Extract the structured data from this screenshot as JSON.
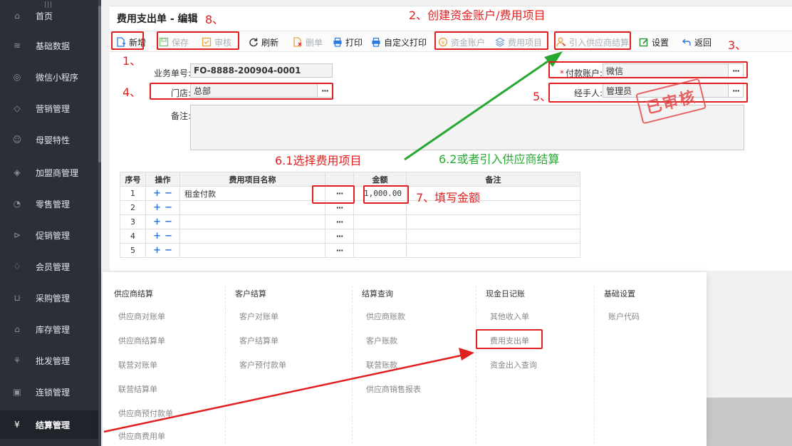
{
  "sidebar": {
    "items": [
      {
        "label": "首页",
        "icon": "home-icon"
      },
      {
        "label": "基础数据",
        "icon": "layers-icon"
      },
      {
        "label": "微信小程序",
        "icon": "mini-program-icon"
      },
      {
        "label": "营销管理",
        "icon": "diamond-icon"
      },
      {
        "label": "母婴特性",
        "icon": "smile-icon"
      },
      {
        "label": "加盟商管理",
        "icon": "franchise-icon"
      },
      {
        "label": "零售管理",
        "icon": "tag-icon"
      },
      {
        "label": "促销管理",
        "icon": "promo-icon"
      },
      {
        "label": "会员管理",
        "icon": "member-icon"
      },
      {
        "label": "采购管理",
        "icon": "cart-icon"
      },
      {
        "label": "库存管理",
        "icon": "warehouse-icon"
      },
      {
        "label": "批发管理",
        "icon": "wholesale-icon"
      },
      {
        "label": "连锁管理",
        "icon": "chain-icon"
      },
      {
        "label": "结算管理",
        "icon": "settlement-icon",
        "active": true
      }
    ]
  },
  "page": {
    "title": "费用支出单 - 编辑"
  },
  "toolbar": {
    "new": "新增",
    "save": "保存",
    "audit": "审核",
    "refresh": "刷新",
    "delete": "删单",
    "print": "打印",
    "custom_print": "自定义打印",
    "fund_account": "资金账户",
    "expense_item": "费用项目",
    "import_supplier": "引入供应商结算",
    "settings": "设置",
    "back": "返回"
  },
  "form": {
    "doc_no_label": "业务单号:",
    "doc_no": "FO-8888-200904-0001",
    "store_label": "门店:",
    "store": "总部",
    "pay_account_label": "付款账户:",
    "pay_account": "微信",
    "handler_label": "经手人:",
    "handler": "管理员",
    "remark_label": "备注:",
    "ellipsis": "···"
  },
  "stamp": {
    "text": "已审核"
  },
  "grid": {
    "headers": [
      "序号",
      "操作",
      "费用项目名称",
      "",
      "金额",
      "备注"
    ],
    "rows": [
      {
        "no": "1",
        "name": "租金付款",
        "amount": "1,000.00",
        "remark": ""
      },
      {
        "no": "2",
        "name": "",
        "amount": "",
        "remark": ""
      },
      {
        "no": "3",
        "name": "",
        "amount": "",
        "remark": ""
      },
      {
        "no": "4",
        "name": "",
        "amount": "",
        "remark": ""
      },
      {
        "no": "5",
        "name": "",
        "amount": "",
        "remark": ""
      }
    ],
    "plus": "+",
    "minus": "−",
    "dots": "···"
  },
  "menu": {
    "columns": [
      {
        "header": "供应商结算",
        "items": [
          "供应商对账单",
          "供应商结算单",
          "联营对账单",
          "联营结算单",
          "供应商预付款单",
          "供应商费用单"
        ]
      },
      {
        "header": "客户结算",
        "items": [
          "客户对账单",
          "客户结算单",
          "客户预付款单"
        ]
      },
      {
        "header": "结算查询",
        "items": [
          "供应商账款",
          "客户账款",
          "联营账款",
          "供应商销售报表"
        ]
      },
      {
        "header": "现金日记账",
        "items": [
          "其他收入单",
          "费用支出单",
          "资金出入查询"
        ]
      },
      {
        "header": "基础设置",
        "items": [
          "账户代码"
        ]
      }
    ]
  },
  "annotations": {
    "a1": "1、",
    "a2": "2、创建资金账户/费用项目",
    "a3": "3、",
    "a4": "4、",
    "a5": "5、",
    "a61": "6.1选择费用项目",
    "a62": "6.2或者引入供应商结算",
    "a7": "7、填写金额",
    "a8": "8、"
  },
  "colors": {
    "sidebar_bg": "#2a2f38",
    "annotation_red": "#e02020",
    "annotation_green": "#27a832",
    "accent_blue": "#2a7ae2"
  }
}
